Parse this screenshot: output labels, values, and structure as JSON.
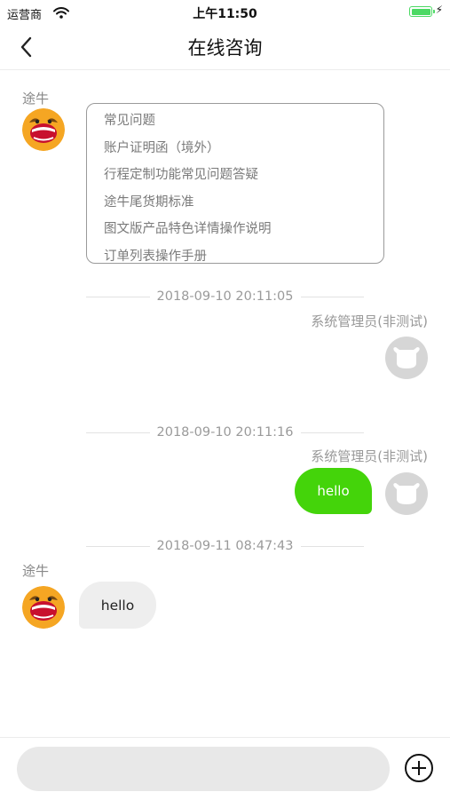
{
  "status_bar": {
    "carrier": "运营商",
    "time": "上午11:50"
  },
  "nav": {
    "title": "在线咨询"
  },
  "bot": {
    "name": "途牛",
    "faq": [
      "常见问题",
      "账户证明函（境外）",
      "行程定制功能常见问题答疑",
      "途牛尾货期标准",
      "图文版产品特色详情操作说明",
      "订单列表操作手册"
    ]
  },
  "timestamps": [
    "2018-09-10 20:11:05",
    "2018-09-10 20:11:16",
    "2018-09-11 08:47:43"
  ],
  "admin": {
    "name": "系统管理员(非测试)"
  },
  "messages": {
    "outgoing": "hello",
    "incoming": "hello"
  },
  "input": {
    "placeholder": ""
  },
  "colors": {
    "sent_bubble": "#44d40a",
    "received_bubble": "#eeeeee",
    "battery": "#4cd964"
  }
}
